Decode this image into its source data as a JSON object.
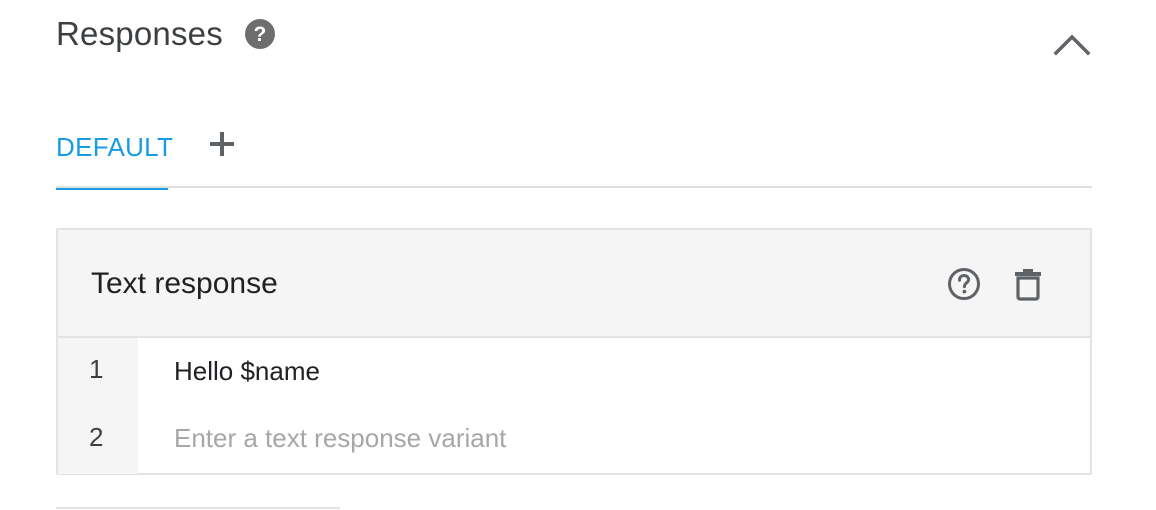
{
  "header": {
    "title": "Responses",
    "help_glyph": "?",
    "help_icon": "help-circle-icon",
    "collapse_icon": "chevron-up-icon"
  },
  "tabs": {
    "items": [
      {
        "label": "DEFAULT",
        "active": true
      }
    ],
    "add_icon": "plus-icon"
  },
  "card": {
    "title": "Text response",
    "help_icon": "help-outline-icon",
    "delete_icon": "trash-icon",
    "rows": [
      {
        "number": "1",
        "text": "Hello $name"
      },
      {
        "number": "2",
        "placeholder": "Enter a text response variant"
      }
    ]
  },
  "colors": {
    "accent": "#1a9be6",
    "header_bg": "#f5f5f5",
    "border": "#e3e3e3",
    "placeholder": "#a7a7a7",
    "icon_gray": "#6e6e6e"
  }
}
